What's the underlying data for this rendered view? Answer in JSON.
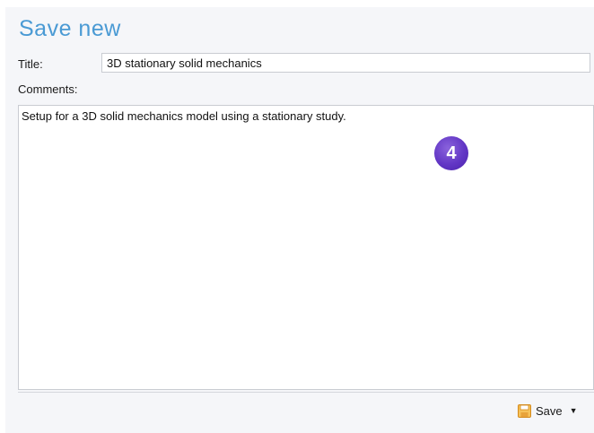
{
  "header": {
    "title": "Save new"
  },
  "form": {
    "title_label": "Title:",
    "title_value": "3D stationary solid mechanics",
    "comments_label": "Comments:",
    "comments_value": "Setup for a 3D solid mechanics model using a stationary study."
  },
  "callout": {
    "number": "4",
    "color": "#6236c5"
  },
  "footer": {
    "save_label": "Save",
    "save_icon": "floppy-disk-icon",
    "menu_icon": "caret-down-icon"
  },
  "colors": {
    "heading": "#4a9ad4",
    "panel_bg": "#f5f6f9",
    "save_icon": "#e8a33a"
  }
}
